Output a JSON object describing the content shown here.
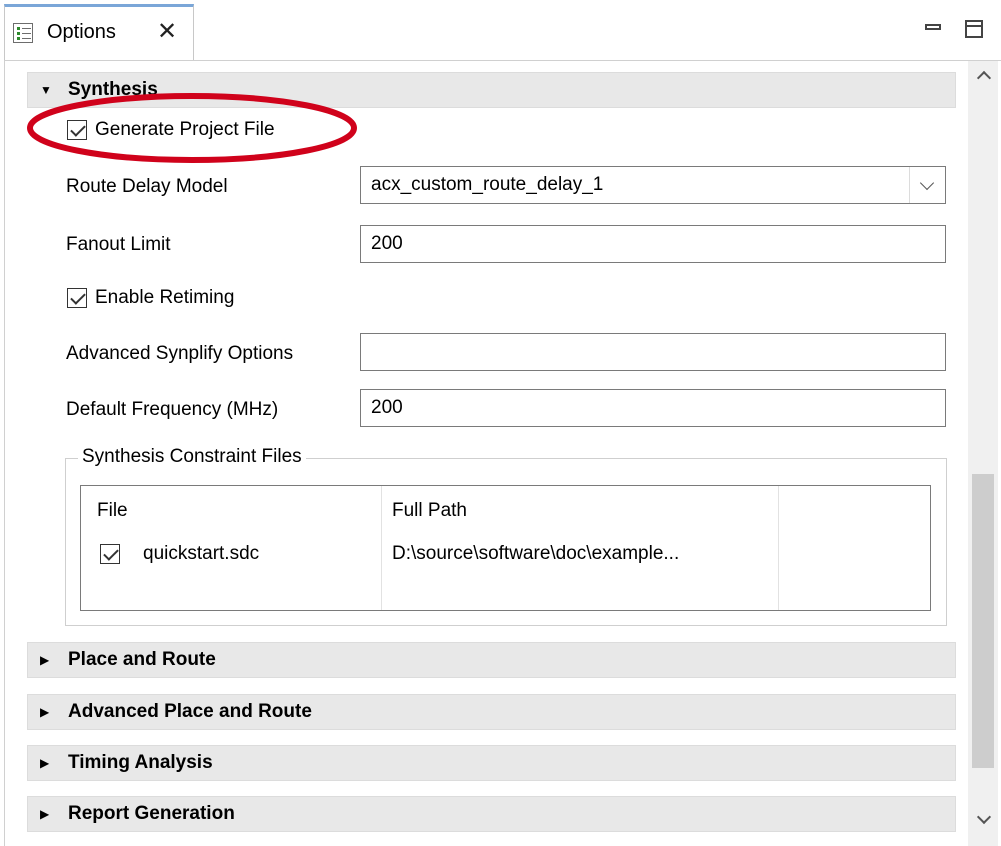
{
  "tab": {
    "title": "Options",
    "close_icon": "close-icon",
    "icon": "options-list-icon"
  },
  "window_controls": {
    "minimize_icon": "minimize-icon",
    "maximize_icon": "maximize-icon"
  },
  "synthesis": {
    "header": "Synthesis",
    "generate_project_file": {
      "label": "Generate Project File",
      "checked": true
    },
    "route_delay_model": {
      "label": "Route Delay Model",
      "value": "acx_custom_route_delay_1"
    },
    "fanout_limit": {
      "label": "Fanout Limit",
      "value": "200"
    },
    "enable_retiming": {
      "label": "Enable Retiming",
      "checked": true
    },
    "advanced_synplify_options": {
      "label": "Advanced Synplify Options",
      "value": ""
    },
    "default_frequency": {
      "label": "Default Frequency (MHz)",
      "value": "200"
    },
    "constraint_files": {
      "group_title": "Synthesis Constraint Files",
      "columns": [
        "File",
        "Full Path"
      ],
      "rows": [
        {
          "checked": true,
          "file": "quickstart.sdc",
          "full_path": "D:\\source\\software\\doc\\example..."
        }
      ]
    }
  },
  "collapsed_sections": [
    {
      "label": "Place and Route"
    },
    {
      "label": "Advanced Place and Route"
    },
    {
      "label": "Timing Analysis"
    },
    {
      "label": "Report Generation"
    }
  ],
  "annotation": {
    "color": "#d0021b",
    "shape": "ellipse"
  }
}
